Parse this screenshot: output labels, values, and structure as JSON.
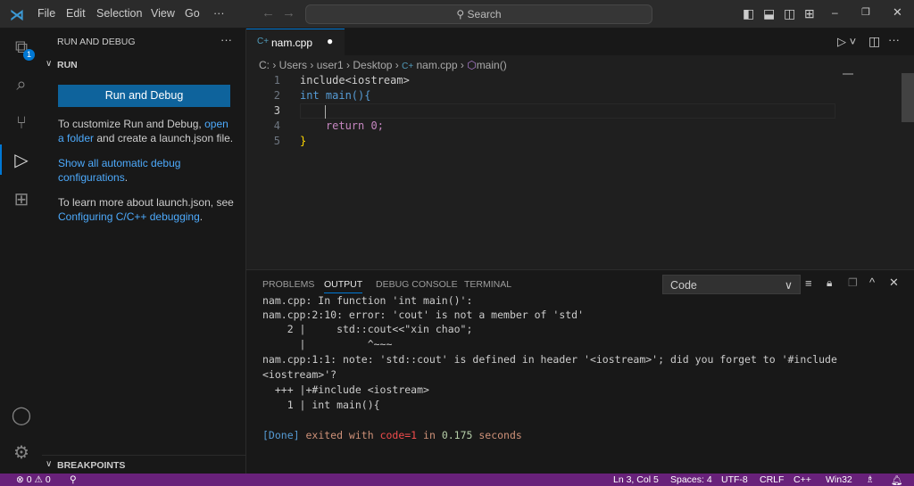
{
  "titlebar": {
    "menu": [
      "File",
      "Edit",
      "Selection",
      "View",
      "Go",
      "···"
    ],
    "search": "Search"
  },
  "activity": {
    "explorer_badge": "1"
  },
  "sidebar": {
    "title": "RUN AND DEBUG",
    "section": "RUN",
    "run_button": "Run and Debug",
    "p1_text": "To customize Run and Debug, ",
    "p1_link": "open a folder",
    "p1_rest": " and create a launch.json file.",
    "p2_link": "Show all automatic debug configurations",
    "p2_rest": ".",
    "p3_text": "To learn more about launch.json, see ",
    "p3_link": "Configuring C/C++ debugging",
    "p3_rest": ".",
    "breakpoints": "BREAKPOINTS"
  },
  "editor": {
    "tab": "nam.cpp",
    "breadcrumbs": [
      "C:",
      "Users",
      "user1",
      "Desktop",
      "nam.cpp",
      "main()"
    ],
    "lines": [
      {
        "n": "1",
        "text": "include<iostream>"
      },
      {
        "n": "2",
        "text": "int main(){"
      },
      {
        "n": "3",
        "text": ""
      },
      {
        "n": "4",
        "text": "    return 0;"
      },
      {
        "n": "5",
        "text": "}"
      }
    ]
  },
  "panel": {
    "tabs": [
      "PROBLEMS",
      "OUTPUT",
      "DEBUG CONSOLE",
      "TERMINAL"
    ],
    "channel": "Code",
    "output": [
      "nam.cpp: In function 'int main()':",
      "nam.cpp:2:10: error: 'cout' is not a member of 'std'",
      "    2 |     std::cout<<\"xin chao\";",
      "      |          ^~~~",
      "nam.cpp:1:1: note: 'std::cout' is defined in header '<iostream>'; did you forget to '#include",
      "<iostream>'?",
      "  +++ |+#include <iostream>",
      "    1 | int main(){"
    ],
    "done": "[Done]",
    "exited": " exited with ",
    "code": "code=1",
    "in": " in ",
    "secs": "0.175",
    "seconds": " seconds"
  },
  "status": {
    "errors": "0",
    "warnings": "0",
    "position": "Ln 3, Col 5",
    "spaces": "Spaces: 4",
    "encoding": "UTF-8",
    "eol": "CRLF",
    "language": "C++",
    "platform": "Win32"
  }
}
